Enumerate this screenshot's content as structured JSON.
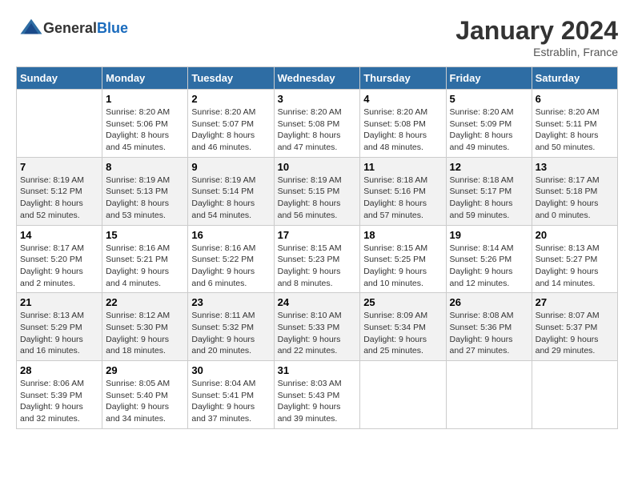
{
  "header": {
    "logo_general": "General",
    "logo_blue": "Blue",
    "month": "January 2024",
    "location": "Estrablin, France"
  },
  "days_of_week": [
    "Sunday",
    "Monday",
    "Tuesday",
    "Wednesday",
    "Thursday",
    "Friday",
    "Saturday"
  ],
  "weeks": [
    [
      {
        "day": "",
        "sunrise": "",
        "sunset": "",
        "daylight": ""
      },
      {
        "day": "1",
        "sunrise": "Sunrise: 8:20 AM",
        "sunset": "Sunset: 5:06 PM",
        "daylight": "Daylight: 8 hours and 45 minutes."
      },
      {
        "day": "2",
        "sunrise": "Sunrise: 8:20 AM",
        "sunset": "Sunset: 5:07 PM",
        "daylight": "Daylight: 8 hours and 46 minutes."
      },
      {
        "day": "3",
        "sunrise": "Sunrise: 8:20 AM",
        "sunset": "Sunset: 5:08 PM",
        "daylight": "Daylight: 8 hours and 47 minutes."
      },
      {
        "day": "4",
        "sunrise": "Sunrise: 8:20 AM",
        "sunset": "Sunset: 5:08 PM",
        "daylight": "Daylight: 8 hours and 48 minutes."
      },
      {
        "day": "5",
        "sunrise": "Sunrise: 8:20 AM",
        "sunset": "Sunset: 5:09 PM",
        "daylight": "Daylight: 8 hours and 49 minutes."
      },
      {
        "day": "6",
        "sunrise": "Sunrise: 8:20 AM",
        "sunset": "Sunset: 5:11 PM",
        "daylight": "Daylight: 8 hours and 50 minutes."
      }
    ],
    [
      {
        "day": "7",
        "sunrise": "Sunrise: 8:19 AM",
        "sunset": "Sunset: 5:12 PM",
        "daylight": "Daylight: 8 hours and 52 minutes."
      },
      {
        "day": "8",
        "sunrise": "Sunrise: 8:19 AM",
        "sunset": "Sunset: 5:13 PM",
        "daylight": "Daylight: 8 hours and 53 minutes."
      },
      {
        "day": "9",
        "sunrise": "Sunrise: 8:19 AM",
        "sunset": "Sunset: 5:14 PM",
        "daylight": "Daylight: 8 hours and 54 minutes."
      },
      {
        "day": "10",
        "sunrise": "Sunrise: 8:19 AM",
        "sunset": "Sunset: 5:15 PM",
        "daylight": "Daylight: 8 hours and 56 minutes."
      },
      {
        "day": "11",
        "sunrise": "Sunrise: 8:18 AM",
        "sunset": "Sunset: 5:16 PM",
        "daylight": "Daylight: 8 hours and 57 minutes."
      },
      {
        "day": "12",
        "sunrise": "Sunrise: 8:18 AM",
        "sunset": "Sunset: 5:17 PM",
        "daylight": "Daylight: 8 hours and 59 minutes."
      },
      {
        "day": "13",
        "sunrise": "Sunrise: 8:17 AM",
        "sunset": "Sunset: 5:18 PM",
        "daylight": "Daylight: 9 hours and 0 minutes."
      }
    ],
    [
      {
        "day": "14",
        "sunrise": "Sunrise: 8:17 AM",
        "sunset": "Sunset: 5:20 PM",
        "daylight": "Daylight: 9 hours and 2 minutes."
      },
      {
        "day": "15",
        "sunrise": "Sunrise: 8:16 AM",
        "sunset": "Sunset: 5:21 PM",
        "daylight": "Daylight: 9 hours and 4 minutes."
      },
      {
        "day": "16",
        "sunrise": "Sunrise: 8:16 AM",
        "sunset": "Sunset: 5:22 PM",
        "daylight": "Daylight: 9 hours and 6 minutes."
      },
      {
        "day": "17",
        "sunrise": "Sunrise: 8:15 AM",
        "sunset": "Sunset: 5:23 PM",
        "daylight": "Daylight: 9 hours and 8 minutes."
      },
      {
        "day": "18",
        "sunrise": "Sunrise: 8:15 AM",
        "sunset": "Sunset: 5:25 PM",
        "daylight": "Daylight: 9 hours and 10 minutes."
      },
      {
        "day": "19",
        "sunrise": "Sunrise: 8:14 AM",
        "sunset": "Sunset: 5:26 PM",
        "daylight": "Daylight: 9 hours and 12 minutes."
      },
      {
        "day": "20",
        "sunrise": "Sunrise: 8:13 AM",
        "sunset": "Sunset: 5:27 PM",
        "daylight": "Daylight: 9 hours and 14 minutes."
      }
    ],
    [
      {
        "day": "21",
        "sunrise": "Sunrise: 8:13 AM",
        "sunset": "Sunset: 5:29 PM",
        "daylight": "Daylight: 9 hours and 16 minutes."
      },
      {
        "day": "22",
        "sunrise": "Sunrise: 8:12 AM",
        "sunset": "Sunset: 5:30 PM",
        "daylight": "Daylight: 9 hours and 18 minutes."
      },
      {
        "day": "23",
        "sunrise": "Sunrise: 8:11 AM",
        "sunset": "Sunset: 5:32 PM",
        "daylight": "Daylight: 9 hours and 20 minutes."
      },
      {
        "day": "24",
        "sunrise": "Sunrise: 8:10 AM",
        "sunset": "Sunset: 5:33 PM",
        "daylight": "Daylight: 9 hours and 22 minutes."
      },
      {
        "day": "25",
        "sunrise": "Sunrise: 8:09 AM",
        "sunset": "Sunset: 5:34 PM",
        "daylight": "Daylight: 9 hours and 25 minutes."
      },
      {
        "day": "26",
        "sunrise": "Sunrise: 8:08 AM",
        "sunset": "Sunset: 5:36 PM",
        "daylight": "Daylight: 9 hours and 27 minutes."
      },
      {
        "day": "27",
        "sunrise": "Sunrise: 8:07 AM",
        "sunset": "Sunset: 5:37 PM",
        "daylight": "Daylight: 9 hours and 29 minutes."
      }
    ],
    [
      {
        "day": "28",
        "sunrise": "Sunrise: 8:06 AM",
        "sunset": "Sunset: 5:39 PM",
        "daylight": "Daylight: 9 hours and 32 minutes."
      },
      {
        "day": "29",
        "sunrise": "Sunrise: 8:05 AM",
        "sunset": "Sunset: 5:40 PM",
        "daylight": "Daylight: 9 hours and 34 minutes."
      },
      {
        "day": "30",
        "sunrise": "Sunrise: 8:04 AM",
        "sunset": "Sunset: 5:41 PM",
        "daylight": "Daylight: 9 hours and 37 minutes."
      },
      {
        "day": "31",
        "sunrise": "Sunrise: 8:03 AM",
        "sunset": "Sunset: 5:43 PM",
        "daylight": "Daylight: 9 hours and 39 minutes."
      },
      {
        "day": "",
        "sunrise": "",
        "sunset": "",
        "daylight": ""
      },
      {
        "day": "",
        "sunrise": "",
        "sunset": "",
        "daylight": ""
      },
      {
        "day": "",
        "sunrise": "",
        "sunset": "",
        "daylight": ""
      }
    ]
  ]
}
